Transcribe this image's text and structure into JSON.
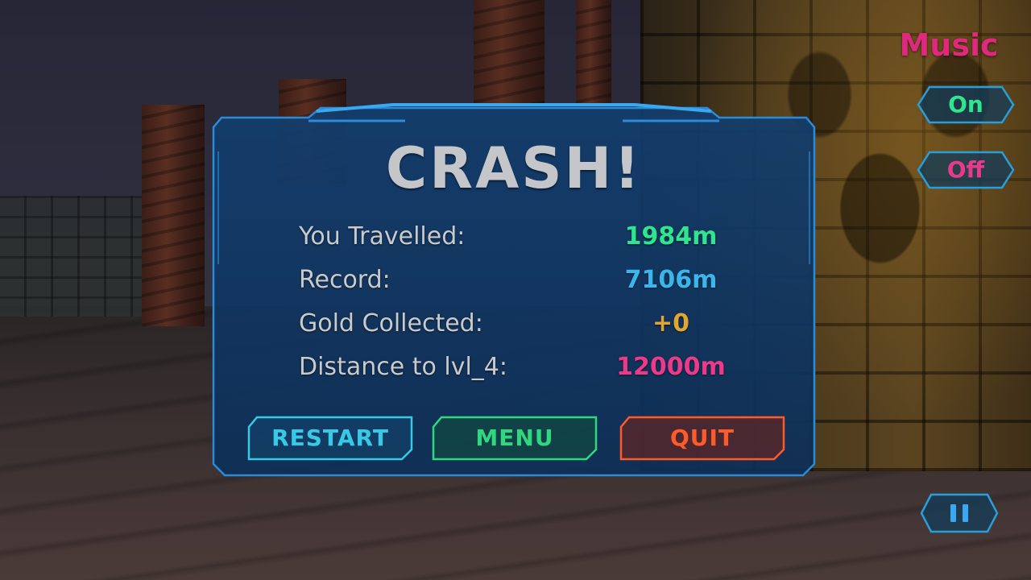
{
  "dialog": {
    "title": "CRASH!",
    "stats": [
      {
        "label": "You Travelled:",
        "value": "1984m",
        "color": "#2ee68f"
      },
      {
        "label": "Record:",
        "value": "7106m",
        "color": "#3bb6ec"
      },
      {
        "label": "Gold Collected:",
        "value": "+0",
        "color": "#e1a531"
      },
      {
        "label": "Distance to lvl_4:",
        "value": "12000m",
        "color": "#ec3a8a"
      }
    ],
    "buttons": {
      "restart": {
        "label": "RESTART",
        "color": "#37c9e6"
      },
      "menu": {
        "label": "MENU",
        "color": "#2fd87f"
      },
      "quit": {
        "label": "QUIT",
        "color": "#ff5a2a"
      }
    }
  },
  "music": {
    "title": "Music",
    "on_label": "On",
    "off_label": "Off",
    "on_color": "#2ee68f",
    "off_color": "#e83a8c"
  },
  "pause_icon": "pause-icon"
}
